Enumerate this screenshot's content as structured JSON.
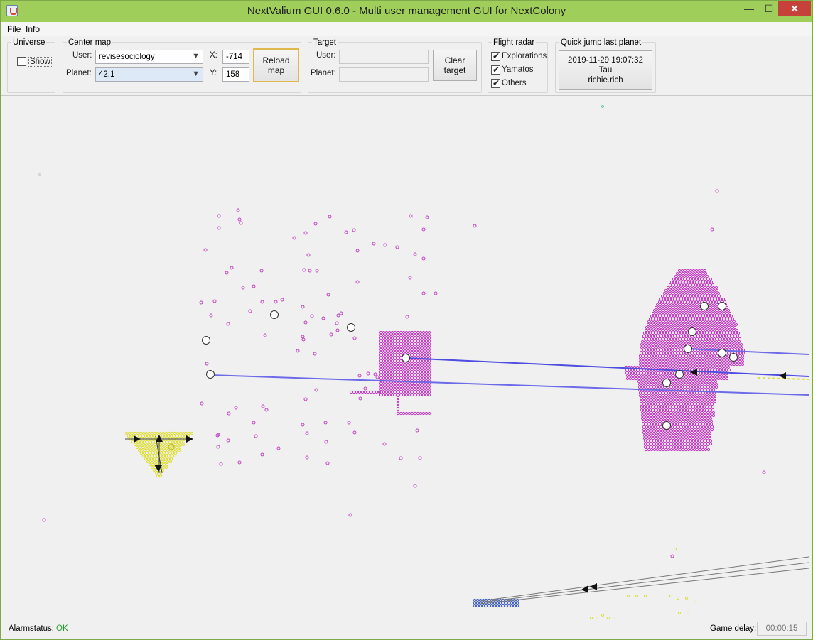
{
  "window": {
    "title": "NextValium GUI 0.6.0 - Multi user management GUI for NextColony",
    "minimize": "—",
    "maximize": "☐",
    "close": "✕"
  },
  "menu": {
    "file": "File",
    "info": "Info"
  },
  "universe": {
    "title": "Universe",
    "show_label": "Show",
    "show_checked": false
  },
  "center_map": {
    "title": "Center map",
    "user_label": "User:",
    "user_value": "revisesociology",
    "planet_label": "Planet:",
    "planet_value": "42.1",
    "x_label": "X:",
    "x_value": "-714",
    "y_label": "Y:",
    "y_value": "158",
    "reload_label_1": "Reload",
    "reload_label_2": "map"
  },
  "target": {
    "title": "Target",
    "user_label": "User:",
    "user_value": "",
    "planet_label": "Planet:",
    "planet_value": "",
    "clear_label_1": "Clear",
    "clear_label_2": "target"
  },
  "flight_radar": {
    "title": "Flight radar",
    "explorations": "Explorations",
    "yamatos": "Yamatos",
    "others": "Others",
    "explorations_checked": true,
    "yamatos_checked": true,
    "others_checked": true
  },
  "quick_jump": {
    "title": "Quick jump last planet",
    "line1": "2019-11-29 19:07:32",
    "line2": "Tau",
    "line3": "richie.rich"
  },
  "status": {
    "alarm_label": "Alarmstatus:",
    "alarm_value": "OK",
    "delay_label": "Game delay:",
    "delay_value": "00:00:15"
  },
  "map_colors": {
    "magenta_planet": "#c23fc2",
    "yellow_planet": "#dede3a",
    "blue_planet": "#3f5fc2",
    "flight_line": "#5a57e6",
    "ok_green": "#1f9c2c"
  }
}
